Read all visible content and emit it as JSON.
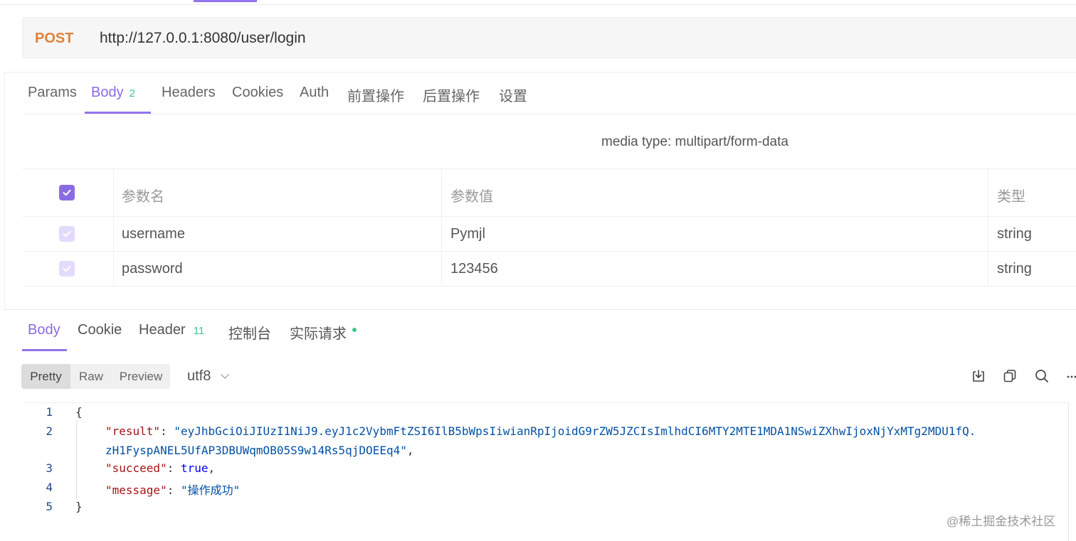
{
  "request": {
    "method": "POST",
    "url": "http://127.0.0.1:8080/user/login",
    "method_color": "#e0813a"
  },
  "request_tabs": [
    {
      "label": "Params"
    },
    {
      "label": "Body",
      "count": "2"
    },
    {
      "label": "Headers"
    },
    {
      "label": "Cookies"
    },
    {
      "label": "Auth"
    },
    {
      "label": "前置操作"
    },
    {
      "label": "后置操作"
    },
    {
      "label": "设置"
    }
  ],
  "body": {
    "media_type": "media type: multipart/form-data",
    "headers": [
      "参数名",
      "参数值",
      "类型"
    ],
    "rows": [
      {
        "name": "username",
        "value": "Pymjl",
        "type": "string"
      },
      {
        "name": "password",
        "value": "123456",
        "type": "string"
      }
    ]
  },
  "response_tabs": [
    {
      "label": "Body"
    },
    {
      "label": "Cookie"
    },
    {
      "label": "Header",
      "count": "11"
    },
    {
      "label": "控制台"
    },
    {
      "label": "实际请求"
    }
  ],
  "view_modes": [
    "Pretty",
    "Raw",
    "Preview"
  ],
  "encoding": "utf8",
  "toolbar_icons": [
    "download-icon",
    "copy-icon",
    "search-icon",
    "more-icon"
  ],
  "response_code": {
    "line_numbers": [
      "1",
      "2",
      "3",
      "4",
      "5"
    ],
    "open_brace": "{",
    "close_brace": "}",
    "result_key": "\"result\"",
    "result_value_1": "\"eyJhbGciOiJIUzI1NiJ9.eyJ1c2VybmFtZSI6IlB5bWpsIiwianRpIjoidG9rZW5JZCIsImlhdCI6MTY2MTE1MDA1NSwiZXhwIjoxNjYxMTg2MDU1fQ.",
    "result_value_2": "zH1FyspANEL5UfAP3DBUWqmOB05S9w14Rs5qjDOEEq4\"",
    "succeed_key": "\"succeed\"",
    "succeed_value": "true",
    "message_key": "\"message\"",
    "message_value": "\"操作成功\""
  },
  "watermark": "@稀土掘金技术社区",
  "colors": {
    "accent": "#8b6be4",
    "count_green": "#3cc68a"
  }
}
